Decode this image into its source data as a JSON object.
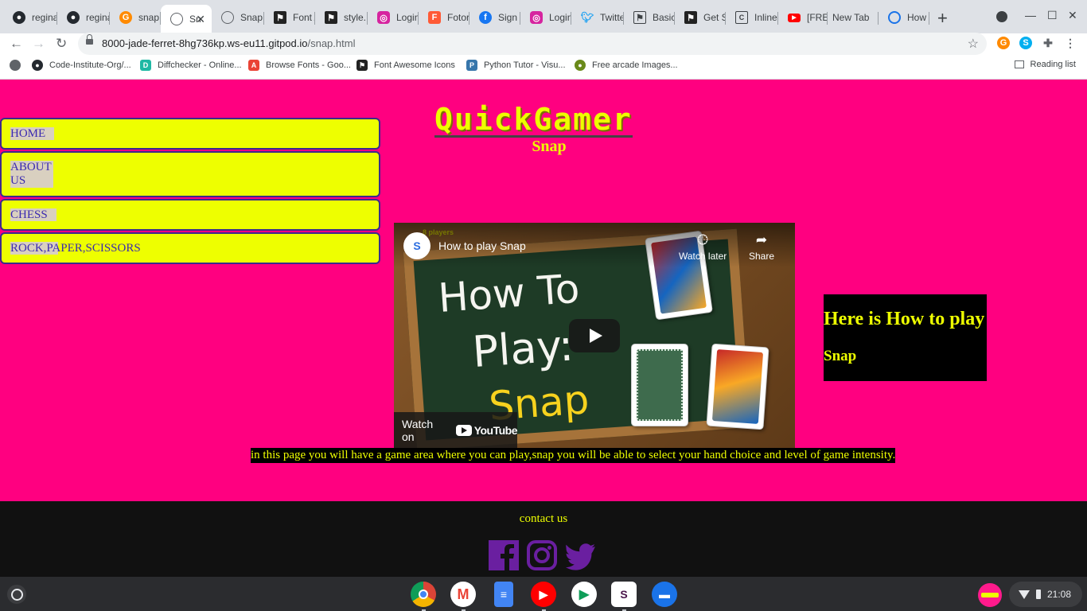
{
  "browser": {
    "tabs": [
      {
        "title": "regina",
        "icon": "github-icon",
        "color": "#24292f"
      },
      {
        "title": "regina",
        "icon": "github-icon",
        "color": "#24292f"
      },
      {
        "title": "snap.",
        "icon": "gitpod-icon",
        "color": "#ff8a00"
      },
      {
        "title": "Sn",
        "icon": "globe-icon",
        "color": "#5f6368",
        "active": true
      },
      {
        "title": "Snap",
        "icon": "globe-icon",
        "color": "#5f6368"
      },
      {
        "title": "Font A",
        "icon": "flag-icon",
        "color": "#222222"
      },
      {
        "title": "style.",
        "icon": "flag-icon",
        "color": "#222222"
      },
      {
        "title": "Login",
        "icon": "instagram-icon",
        "color": "#d6249f"
      },
      {
        "title": "Fotor",
        "icon": "fotor-icon",
        "color": "#ff5a36"
      },
      {
        "title": "Sign u",
        "icon": "facebook-icon",
        "color": "#1877f2"
      },
      {
        "title": "Login",
        "icon": "instagram-icon",
        "color": "#d6249f"
      },
      {
        "title": "Twitte",
        "icon": "twitter-icon",
        "color": "#1da1f2"
      },
      {
        "title": "Basic",
        "icon": "flag-icon",
        "color": "#3c4043"
      },
      {
        "title": "Get St",
        "icon": "flag-icon",
        "color": "#222222"
      },
      {
        "title": "Inline",
        "icon": "page-icon",
        "color": "#3c4043"
      },
      {
        "title": "[FREE",
        "icon": "youtube-icon",
        "color": "#ff0000"
      },
      {
        "title": "New Tab",
        "icon": "",
        "color": ""
      },
      {
        "title": "How",
        "icon": "sync-icon",
        "color": "#1a73e8"
      }
    ],
    "url_host": "8000-jade-ferret-8hg736kp.ws-eu11.gitpod.io",
    "url_path": "/snap.html",
    "bookmarks": [
      {
        "label": "",
        "icon": "globe-icon",
        "color": "#5f6368"
      },
      {
        "label": "Code-Institute-Org/...",
        "icon": "github-icon",
        "color": "#24292f"
      },
      {
        "label": "Diffchecker - Online...",
        "icon": "diffchecker-icon",
        "color": "#1fb8a4"
      },
      {
        "label": "Browse Fonts - Goo...",
        "icon": "google-fonts-icon",
        "color": "#ea4335"
      },
      {
        "label": "Font Awesome Icons",
        "icon": "flag-icon",
        "color": "#222222"
      },
      {
        "label": "Python Tutor - Visu...",
        "icon": "python-icon",
        "color": "#3776ab"
      },
      {
        "label": "Free arcade Images...",
        "icon": "arcade-icon",
        "color": "#6a8a1a"
      }
    ],
    "reading_list": "Reading list"
  },
  "page": {
    "nav": [
      "HOME",
      "ABOUT US",
      "CHESS",
      "ROCK,PAPER,SCISSORS"
    ],
    "brand": "QuickGamer",
    "subtitle": "Snap",
    "video": {
      "title": "How to play Snap",
      "players_badge": "8 players",
      "channel_logo": "S",
      "watch_later": "Watch later",
      "share": "Share",
      "watch_on": "Watch on",
      "youtube": "YouTube",
      "thumb_line1": "How To",
      "thumb_line2": "Play:",
      "thumb_line3": "Snap"
    },
    "howto_line1": "Here is How to play",
    "howto_line2": "Snap",
    "description": "in this page you will have a game area where you can play,snap you will be able to select your hand choice and level of game intensity.",
    "footer": {
      "contact": "contact us",
      "socials": [
        "facebook-icon",
        "instagram-icon",
        "twitter-icon"
      ],
      "social_color": "#6a1fa0"
    }
  },
  "shelf": {
    "apps": [
      {
        "name": "chrome-icon",
        "color": "#ffffff"
      },
      {
        "name": "gmail-icon",
        "color": "#ffffff"
      },
      {
        "name": "google-docs-icon",
        "color": "#4285f4"
      },
      {
        "name": "youtube-icon",
        "color": "#ff0000"
      },
      {
        "name": "play-store-icon",
        "color": "#ffffff"
      },
      {
        "name": "slack-icon",
        "color": "#ffffff"
      },
      {
        "name": "files-icon",
        "color": "#1a73e8"
      }
    ],
    "time": "21:08"
  },
  "colors": {
    "page_bg": "#ff0080",
    "accent_yellow": "#eeff00",
    "nav_border": "#3b2a8c",
    "footer_bg": "#111111"
  }
}
